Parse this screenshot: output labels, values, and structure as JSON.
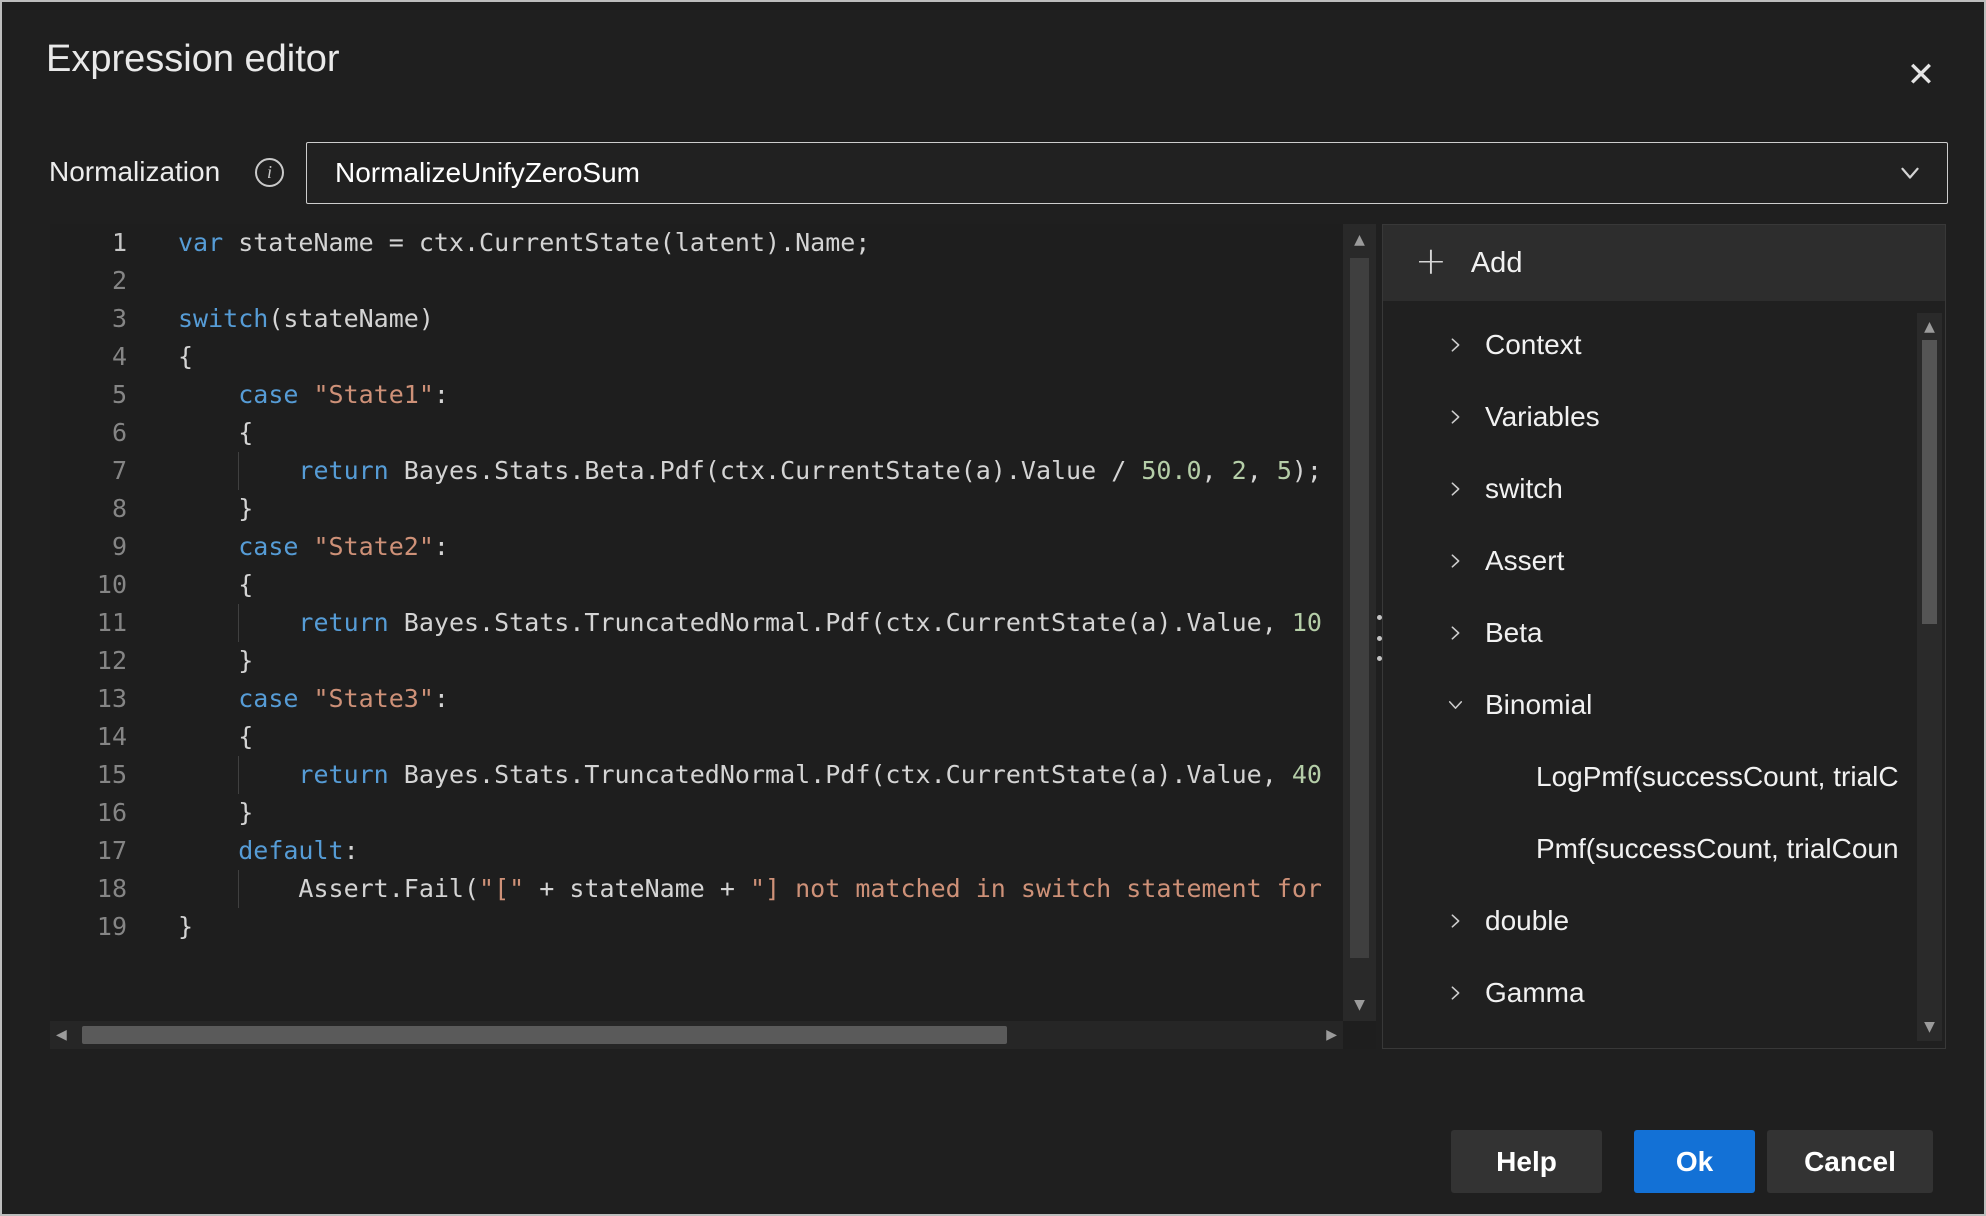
{
  "colors": {
    "accent": "#1371d6",
    "keyword": "#569cd6",
    "plain": "#d4d4d4",
    "string": "#ce9178",
    "number": "#b5cea8"
  },
  "icons": {
    "close": "✕",
    "plus": "+",
    "info": "i",
    "arrow_up": "▲",
    "arrow_down": "▼",
    "arrow_left": "◀",
    "arrow_right": "▶"
  },
  "dialog": {
    "title": "Expression editor"
  },
  "normalization": {
    "label": "Normalization",
    "value": "NormalizeUnifyZeroSum"
  },
  "editor": {
    "lines": [
      {
        "n": "1",
        "segs": [
          [
            "kw",
            "var"
          ],
          [
            "pl",
            " stateName = ctx.CurrentState(latent).Name;"
          ]
        ]
      },
      {
        "n": "2",
        "segs": []
      },
      {
        "n": "3",
        "segs": [
          [
            "kw",
            "switch"
          ],
          [
            "pl",
            "(stateName)"
          ]
        ]
      },
      {
        "n": "4",
        "segs": [
          [
            "pl",
            "{"
          ]
        ]
      },
      {
        "n": "5",
        "segs": [
          [
            "pl",
            "    "
          ],
          [
            "kw",
            "case"
          ],
          [
            "pl",
            " "
          ],
          [
            "str",
            "\"State1\""
          ],
          [
            "pl",
            ":"
          ]
        ]
      },
      {
        "n": "6",
        "segs": [
          [
            "pl",
            "    {"
          ]
        ]
      },
      {
        "n": "7",
        "segs": [
          [
            "pl",
            "        "
          ],
          [
            "kw",
            "return"
          ],
          [
            "pl",
            " Bayes.Stats.Beta.Pdf(ctx.CurrentState(a).Value / "
          ],
          [
            "num",
            "50.0"
          ],
          [
            "pl",
            ", "
          ],
          [
            "num",
            "2"
          ],
          [
            "pl",
            ", "
          ],
          [
            "num",
            "5"
          ],
          [
            "pl",
            ");"
          ]
        ]
      },
      {
        "n": "8",
        "segs": [
          [
            "pl",
            "    }"
          ]
        ]
      },
      {
        "n": "9",
        "segs": [
          [
            "pl",
            "    "
          ],
          [
            "kw",
            "case"
          ],
          [
            "pl",
            " "
          ],
          [
            "str",
            "\"State2\""
          ],
          [
            "pl",
            ":"
          ]
        ]
      },
      {
        "n": "10",
        "segs": [
          [
            "pl",
            "    {"
          ]
        ]
      },
      {
        "n": "11",
        "segs": [
          [
            "pl",
            "        "
          ],
          [
            "kw",
            "return"
          ],
          [
            "pl",
            " Bayes.Stats.TruncatedNormal.Pdf(ctx.CurrentState(a).Value, "
          ],
          [
            "num",
            "10"
          ]
        ]
      },
      {
        "n": "12",
        "segs": [
          [
            "pl",
            "    }"
          ]
        ]
      },
      {
        "n": "13",
        "segs": [
          [
            "pl",
            "    "
          ],
          [
            "kw",
            "case"
          ],
          [
            "pl",
            " "
          ],
          [
            "str",
            "\"State3\""
          ],
          [
            "pl",
            ":"
          ]
        ]
      },
      {
        "n": "14",
        "segs": [
          [
            "pl",
            "    {"
          ]
        ]
      },
      {
        "n": "15",
        "segs": [
          [
            "pl",
            "        "
          ],
          [
            "kw",
            "return"
          ],
          [
            "pl",
            " Bayes.Stats.TruncatedNormal.Pdf(ctx.CurrentState(a).Value, "
          ],
          [
            "num",
            "40"
          ]
        ]
      },
      {
        "n": "16",
        "segs": [
          [
            "pl",
            "    }"
          ]
        ]
      },
      {
        "n": "17",
        "segs": [
          [
            "pl",
            "    "
          ],
          [
            "kw",
            "default"
          ],
          [
            "pl",
            ":"
          ]
        ]
      },
      {
        "n": "18",
        "segs": [
          [
            "pl",
            "        Assert.Fail("
          ],
          [
            "str",
            "\"[\""
          ],
          [
            "pl",
            " + stateName + "
          ],
          [
            "str",
            "\"] not matched in switch statement for"
          ]
        ]
      },
      {
        "n": "19",
        "segs": [
          [
            "pl",
            "}"
          ]
        ]
      }
    ]
  },
  "panel": {
    "add_label": "Add",
    "items": [
      {
        "label": "Context",
        "type": "collapsed"
      },
      {
        "label": "Variables",
        "type": "collapsed"
      },
      {
        "label": "switch",
        "type": "collapsed"
      },
      {
        "label": "Assert",
        "type": "collapsed"
      },
      {
        "label": "Beta",
        "type": "collapsed"
      },
      {
        "label": "Binomial",
        "type": "expanded"
      },
      {
        "label": "LogPmf(successCount, trialC",
        "type": "leaf"
      },
      {
        "label": "Pmf(successCount, trialCoun",
        "type": "leaf"
      },
      {
        "label": "double",
        "type": "collapsed"
      },
      {
        "label": "Gamma",
        "type": "collapsed"
      }
    ]
  },
  "footer": {
    "help_label": "Help",
    "ok_label": "Ok",
    "cancel_label": "Cancel"
  }
}
